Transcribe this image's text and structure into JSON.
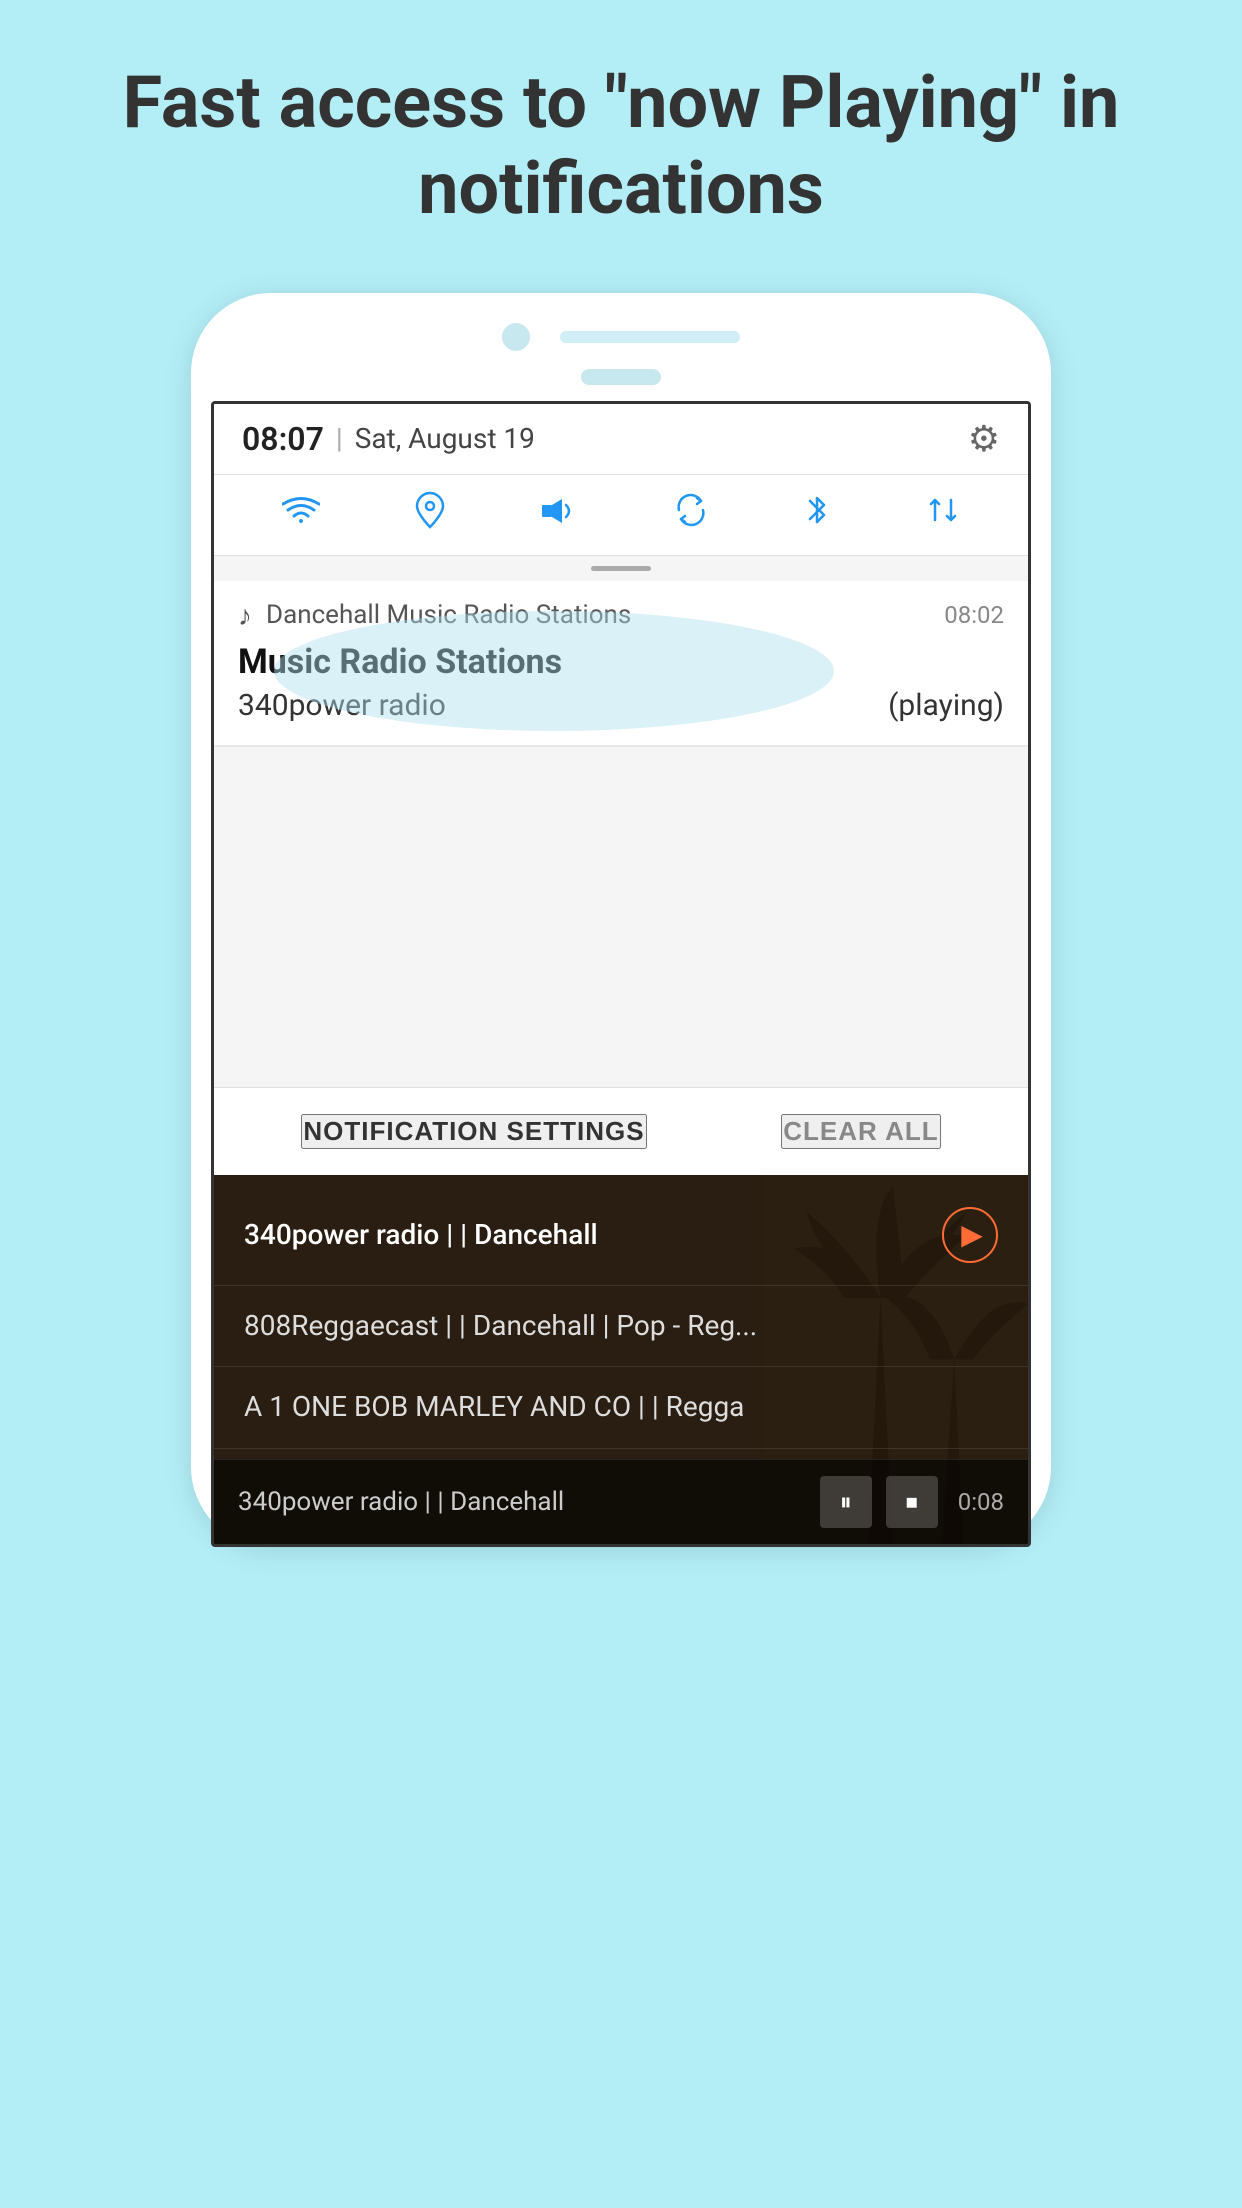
{
  "header": {
    "title": "Fast access to \"now Playing\" in notifications"
  },
  "statusBar": {
    "time": "08:07",
    "separator": "|",
    "date": "Sat, August 19",
    "gearIcon": "⚙"
  },
  "quickSettings": {
    "icons": [
      "wifi",
      "location",
      "volume",
      "sync",
      "bluetooth",
      "transfer"
    ]
  },
  "notification": {
    "appIcon": "♪",
    "appName": "Dancehall Music Radio Stations",
    "time": "08:02",
    "title": "Music Radio Stations",
    "station": "340power radio",
    "status": "(playing)"
  },
  "notifFooter": {
    "settingsLabel": "NOTIFICATION SETTINGS",
    "clearLabel": "CLEAR ALL"
  },
  "radioList": {
    "items": [
      {
        "text": "340power radio | | Dancehall",
        "hasPlayButton": true
      },
      {
        "text": "808Reggaecast | | Dancehall | Pop - Reg...",
        "hasPlayButton": false
      },
      {
        "text": "A 1 ONE BOB MARLEY AND CO | | Regga",
        "hasPlayButton": false
      }
    ]
  },
  "playingBar": {
    "text": "340power radio | | Dancehall",
    "time": "0:08",
    "pauseIcon": "⏸",
    "stopIcon": "⏹"
  }
}
